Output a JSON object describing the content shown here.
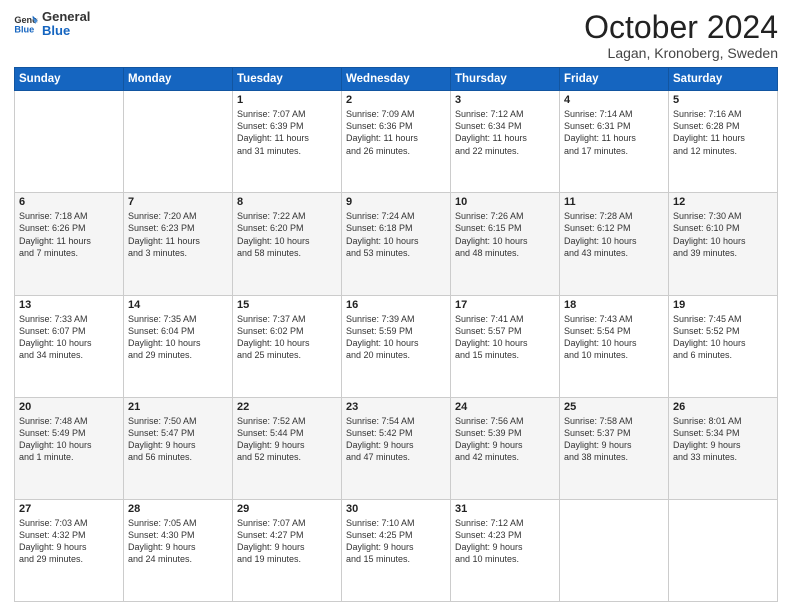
{
  "header": {
    "logo_line1": "General",
    "logo_line2": "Blue",
    "month": "October 2024",
    "location": "Lagan, Kronoberg, Sweden"
  },
  "days_of_week": [
    "Sunday",
    "Monday",
    "Tuesday",
    "Wednesday",
    "Thursday",
    "Friday",
    "Saturday"
  ],
  "weeks": [
    [
      {
        "day": "",
        "content": ""
      },
      {
        "day": "",
        "content": ""
      },
      {
        "day": "1",
        "content": "Sunrise: 7:07 AM\nSunset: 6:39 PM\nDaylight: 11 hours\nand 31 minutes."
      },
      {
        "day": "2",
        "content": "Sunrise: 7:09 AM\nSunset: 6:36 PM\nDaylight: 11 hours\nand 26 minutes."
      },
      {
        "day": "3",
        "content": "Sunrise: 7:12 AM\nSunset: 6:34 PM\nDaylight: 11 hours\nand 22 minutes."
      },
      {
        "day": "4",
        "content": "Sunrise: 7:14 AM\nSunset: 6:31 PM\nDaylight: 11 hours\nand 17 minutes."
      },
      {
        "day": "5",
        "content": "Sunrise: 7:16 AM\nSunset: 6:28 PM\nDaylight: 11 hours\nand 12 minutes."
      }
    ],
    [
      {
        "day": "6",
        "content": "Sunrise: 7:18 AM\nSunset: 6:26 PM\nDaylight: 11 hours\nand 7 minutes."
      },
      {
        "day": "7",
        "content": "Sunrise: 7:20 AM\nSunset: 6:23 PM\nDaylight: 11 hours\nand 3 minutes."
      },
      {
        "day": "8",
        "content": "Sunrise: 7:22 AM\nSunset: 6:20 PM\nDaylight: 10 hours\nand 58 minutes."
      },
      {
        "day": "9",
        "content": "Sunrise: 7:24 AM\nSunset: 6:18 PM\nDaylight: 10 hours\nand 53 minutes."
      },
      {
        "day": "10",
        "content": "Sunrise: 7:26 AM\nSunset: 6:15 PM\nDaylight: 10 hours\nand 48 minutes."
      },
      {
        "day": "11",
        "content": "Sunrise: 7:28 AM\nSunset: 6:12 PM\nDaylight: 10 hours\nand 43 minutes."
      },
      {
        "day": "12",
        "content": "Sunrise: 7:30 AM\nSunset: 6:10 PM\nDaylight: 10 hours\nand 39 minutes."
      }
    ],
    [
      {
        "day": "13",
        "content": "Sunrise: 7:33 AM\nSunset: 6:07 PM\nDaylight: 10 hours\nand 34 minutes."
      },
      {
        "day": "14",
        "content": "Sunrise: 7:35 AM\nSunset: 6:04 PM\nDaylight: 10 hours\nand 29 minutes."
      },
      {
        "day": "15",
        "content": "Sunrise: 7:37 AM\nSunset: 6:02 PM\nDaylight: 10 hours\nand 25 minutes."
      },
      {
        "day": "16",
        "content": "Sunrise: 7:39 AM\nSunset: 5:59 PM\nDaylight: 10 hours\nand 20 minutes."
      },
      {
        "day": "17",
        "content": "Sunrise: 7:41 AM\nSunset: 5:57 PM\nDaylight: 10 hours\nand 15 minutes."
      },
      {
        "day": "18",
        "content": "Sunrise: 7:43 AM\nSunset: 5:54 PM\nDaylight: 10 hours\nand 10 minutes."
      },
      {
        "day": "19",
        "content": "Sunrise: 7:45 AM\nSunset: 5:52 PM\nDaylight: 10 hours\nand 6 minutes."
      }
    ],
    [
      {
        "day": "20",
        "content": "Sunrise: 7:48 AM\nSunset: 5:49 PM\nDaylight: 10 hours\nand 1 minute."
      },
      {
        "day": "21",
        "content": "Sunrise: 7:50 AM\nSunset: 5:47 PM\nDaylight: 9 hours\nand 56 minutes."
      },
      {
        "day": "22",
        "content": "Sunrise: 7:52 AM\nSunset: 5:44 PM\nDaylight: 9 hours\nand 52 minutes."
      },
      {
        "day": "23",
        "content": "Sunrise: 7:54 AM\nSunset: 5:42 PM\nDaylight: 9 hours\nand 47 minutes."
      },
      {
        "day": "24",
        "content": "Sunrise: 7:56 AM\nSunset: 5:39 PM\nDaylight: 9 hours\nand 42 minutes."
      },
      {
        "day": "25",
        "content": "Sunrise: 7:58 AM\nSunset: 5:37 PM\nDaylight: 9 hours\nand 38 minutes."
      },
      {
        "day": "26",
        "content": "Sunrise: 8:01 AM\nSunset: 5:34 PM\nDaylight: 9 hours\nand 33 minutes."
      }
    ],
    [
      {
        "day": "27",
        "content": "Sunrise: 7:03 AM\nSunset: 4:32 PM\nDaylight: 9 hours\nand 29 minutes."
      },
      {
        "day": "28",
        "content": "Sunrise: 7:05 AM\nSunset: 4:30 PM\nDaylight: 9 hours\nand 24 minutes."
      },
      {
        "day": "29",
        "content": "Sunrise: 7:07 AM\nSunset: 4:27 PM\nDaylight: 9 hours\nand 19 minutes."
      },
      {
        "day": "30",
        "content": "Sunrise: 7:10 AM\nSunset: 4:25 PM\nDaylight: 9 hours\nand 15 minutes."
      },
      {
        "day": "31",
        "content": "Sunrise: 7:12 AM\nSunset: 4:23 PM\nDaylight: 9 hours\nand 10 minutes."
      },
      {
        "day": "",
        "content": ""
      },
      {
        "day": "",
        "content": ""
      }
    ]
  ]
}
